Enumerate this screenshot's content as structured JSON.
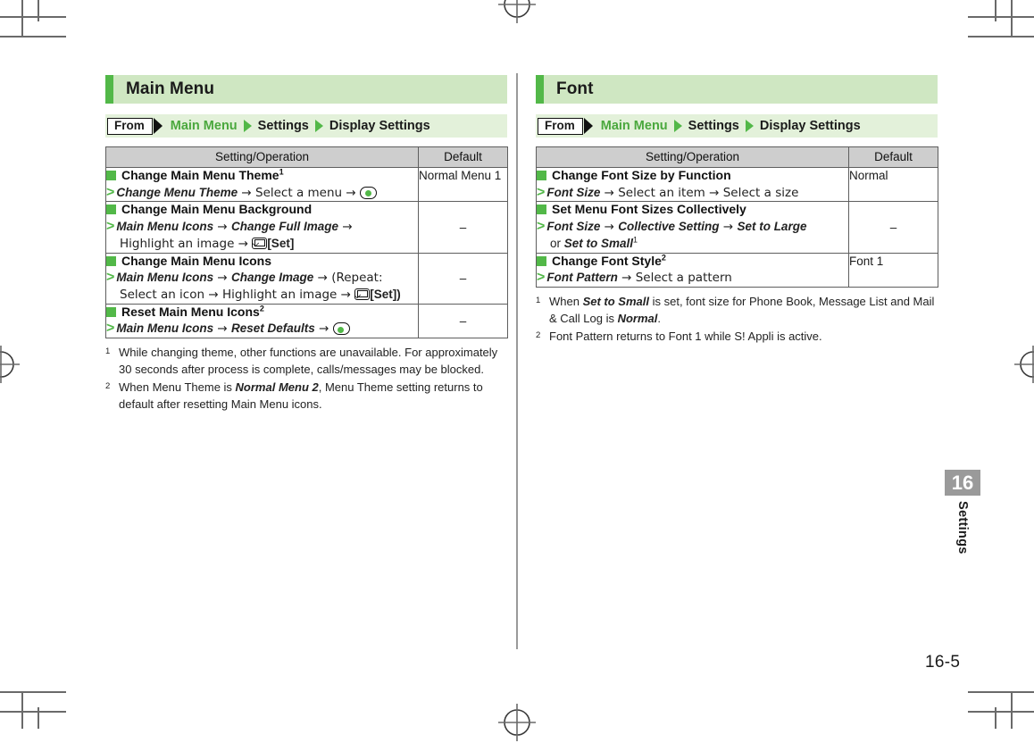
{
  "page": {
    "number": "16-5",
    "chapter_number": "16",
    "chapter_name": "Settings"
  },
  "columns": [
    {
      "title": "Main Menu",
      "from": {
        "label": "From",
        "crumbs": [
          "Main Menu",
          "Settings",
          "Display Settings"
        ]
      },
      "table": {
        "headers": [
          "Setting/Operation",
          "Default"
        ],
        "rows": [
          {
            "title": "Change Main Menu Theme",
            "title_sup": "1",
            "steps_line1_bi": "Change Menu Theme",
            "steps_line1_rest": " → Select a menu → ",
            "steps_key": "center-key",
            "default": "Normal Menu 1",
            "default_center": false
          },
          {
            "title": "Change Main Menu Background",
            "title_sup": "",
            "steps_line1_bi": "Main Menu Icons",
            "steps_line1_rest": " → ",
            "steps_line1_bi2": "Change Full Image",
            "steps_line1_rest2": " →",
            "steps_line2_pre": "Highlight an image → ",
            "steps_key": "mail-key",
            "steps_line2_post": "[Set]",
            "default": "–",
            "default_center": true
          },
          {
            "title": "Change Main Menu Icons",
            "title_sup": "",
            "steps_line1_bi": "Main Menu Icons",
            "steps_line1_rest": " → ",
            "steps_line1_bi2": "Change Image",
            "steps_line1_rest2": " → (Repeat:",
            "steps_line2_pre": "Select an icon → Highlight an image → ",
            "steps_key": "mail-key",
            "steps_line2_post": "[Set])",
            "default": "–",
            "default_center": true
          },
          {
            "title": "Reset Main Menu Icons",
            "title_sup": "2",
            "steps_line1_bi": "Main Menu Icons",
            "steps_line1_rest": " → ",
            "steps_line1_bi2": "Reset Defaults",
            "steps_line1_rest2": " → ",
            "steps_key": "center-key",
            "default": "–",
            "default_center": true
          }
        ]
      },
      "footnotes": [
        {
          "num": "1",
          "text": "While changing theme, other functions are unavailable. For approximately 30 seconds after process is complete, calls/messages may be blocked."
        },
        {
          "num": "2",
          "pre": "When Menu Theme is ",
          "bold": "Normal Menu 2",
          "post": ", Menu Theme setting returns to default after resetting Main Menu icons."
        }
      ]
    },
    {
      "title": "Font",
      "from": {
        "label": "From",
        "crumbs": [
          "Main Menu",
          "Settings",
          "Display Settings"
        ]
      },
      "table": {
        "headers": [
          "Setting/Operation",
          "Default"
        ],
        "rows": [
          {
            "title": "Change Font Size by Function",
            "title_sup": "",
            "steps_line1_bi": "Font Size",
            "steps_line1_rest": " → Select an item → Select a size",
            "default": "Normal",
            "default_center": false
          },
          {
            "title": "Set Menu Font Sizes Collectively",
            "title_sup": "",
            "steps_line1_bi": "Font Size",
            "steps_line1_rest": " → ",
            "steps_line1_bi2": "Collective Setting",
            "steps_line1_rest2": " → ",
            "steps_line1_bi3": "Set to Large",
            "steps_line2_pre": "or ",
            "steps_line2_bi": "Set to Small",
            "steps_line2_sup": "1",
            "default": "–",
            "default_center": true
          },
          {
            "title": "Change Font Style",
            "title_sup": "2",
            "steps_line1_bi": "Font Pattern",
            "steps_line1_rest": " → Select a pattern",
            "default": "Font 1",
            "default_center": false
          }
        ]
      },
      "footnotes": [
        {
          "num": "1",
          "pre": "When ",
          "bold": "Set to Small",
          "mid": " is set, font size for Phone Book, Message List and Mail & Call Log is ",
          "bold2": "Normal",
          "post": "."
        },
        {
          "num": "2",
          "text": "Font Pattern returns to Font 1 while S! Appli is active."
        }
      ]
    }
  ]
}
